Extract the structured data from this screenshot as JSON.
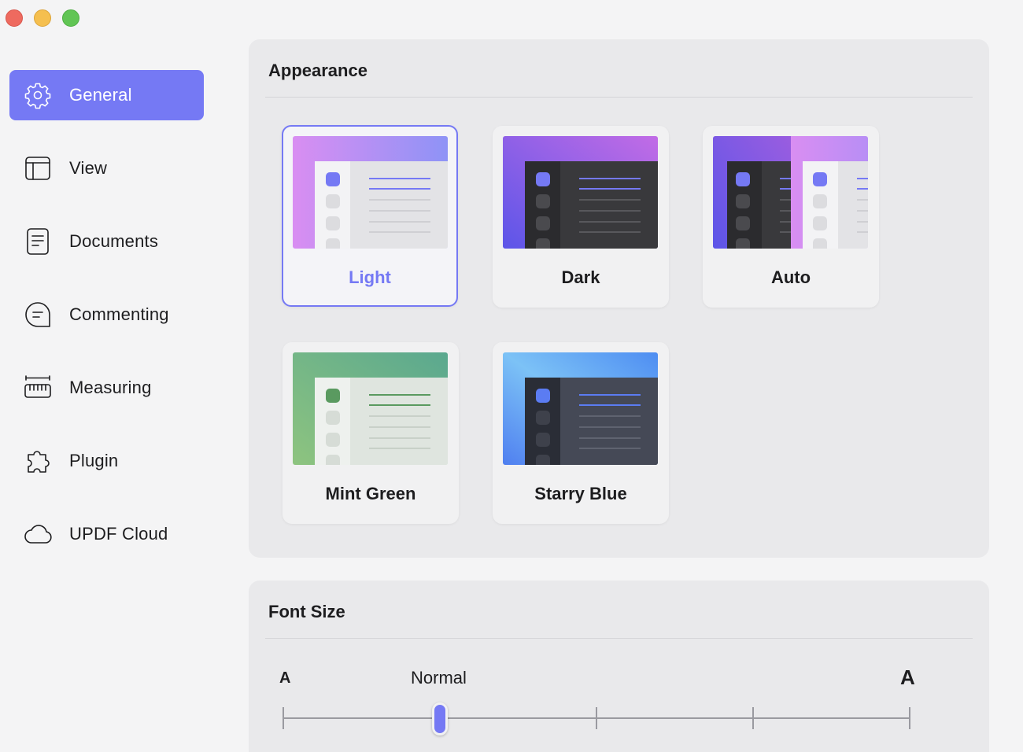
{
  "window": {
    "controls": [
      "close",
      "minimize",
      "maximize"
    ]
  },
  "sidebar": {
    "items": [
      {
        "label": "General",
        "icon": "gear-icon",
        "active": true
      },
      {
        "label": "View",
        "icon": "layout-icon",
        "active": false
      },
      {
        "label": "Documents",
        "icon": "document-icon",
        "active": false
      },
      {
        "label": "Commenting",
        "icon": "comment-icon",
        "active": false
      },
      {
        "label": "Measuring",
        "icon": "ruler-icon",
        "active": false
      },
      {
        "label": "Plugin",
        "icon": "puzzle-icon",
        "active": false
      },
      {
        "label": "UPDF Cloud",
        "icon": "cloud-icon",
        "active": false
      }
    ]
  },
  "appearance": {
    "title": "Appearance",
    "themes": [
      {
        "label": "Light",
        "selected": true
      },
      {
        "label": "Dark",
        "selected": false
      },
      {
        "label": "Auto",
        "selected": false
      },
      {
        "label": "Mint Green",
        "selected": false
      },
      {
        "label": "Starry Blue",
        "selected": false
      }
    ]
  },
  "font_size": {
    "title": "Font Size",
    "small_label": "A",
    "current_label": "Normal",
    "large_label": "A",
    "steps": 5,
    "current_step": 2
  },
  "colors": {
    "accent": "#7579f4",
    "background": "#f4f4f5",
    "panel": "#e9e9eb"
  }
}
